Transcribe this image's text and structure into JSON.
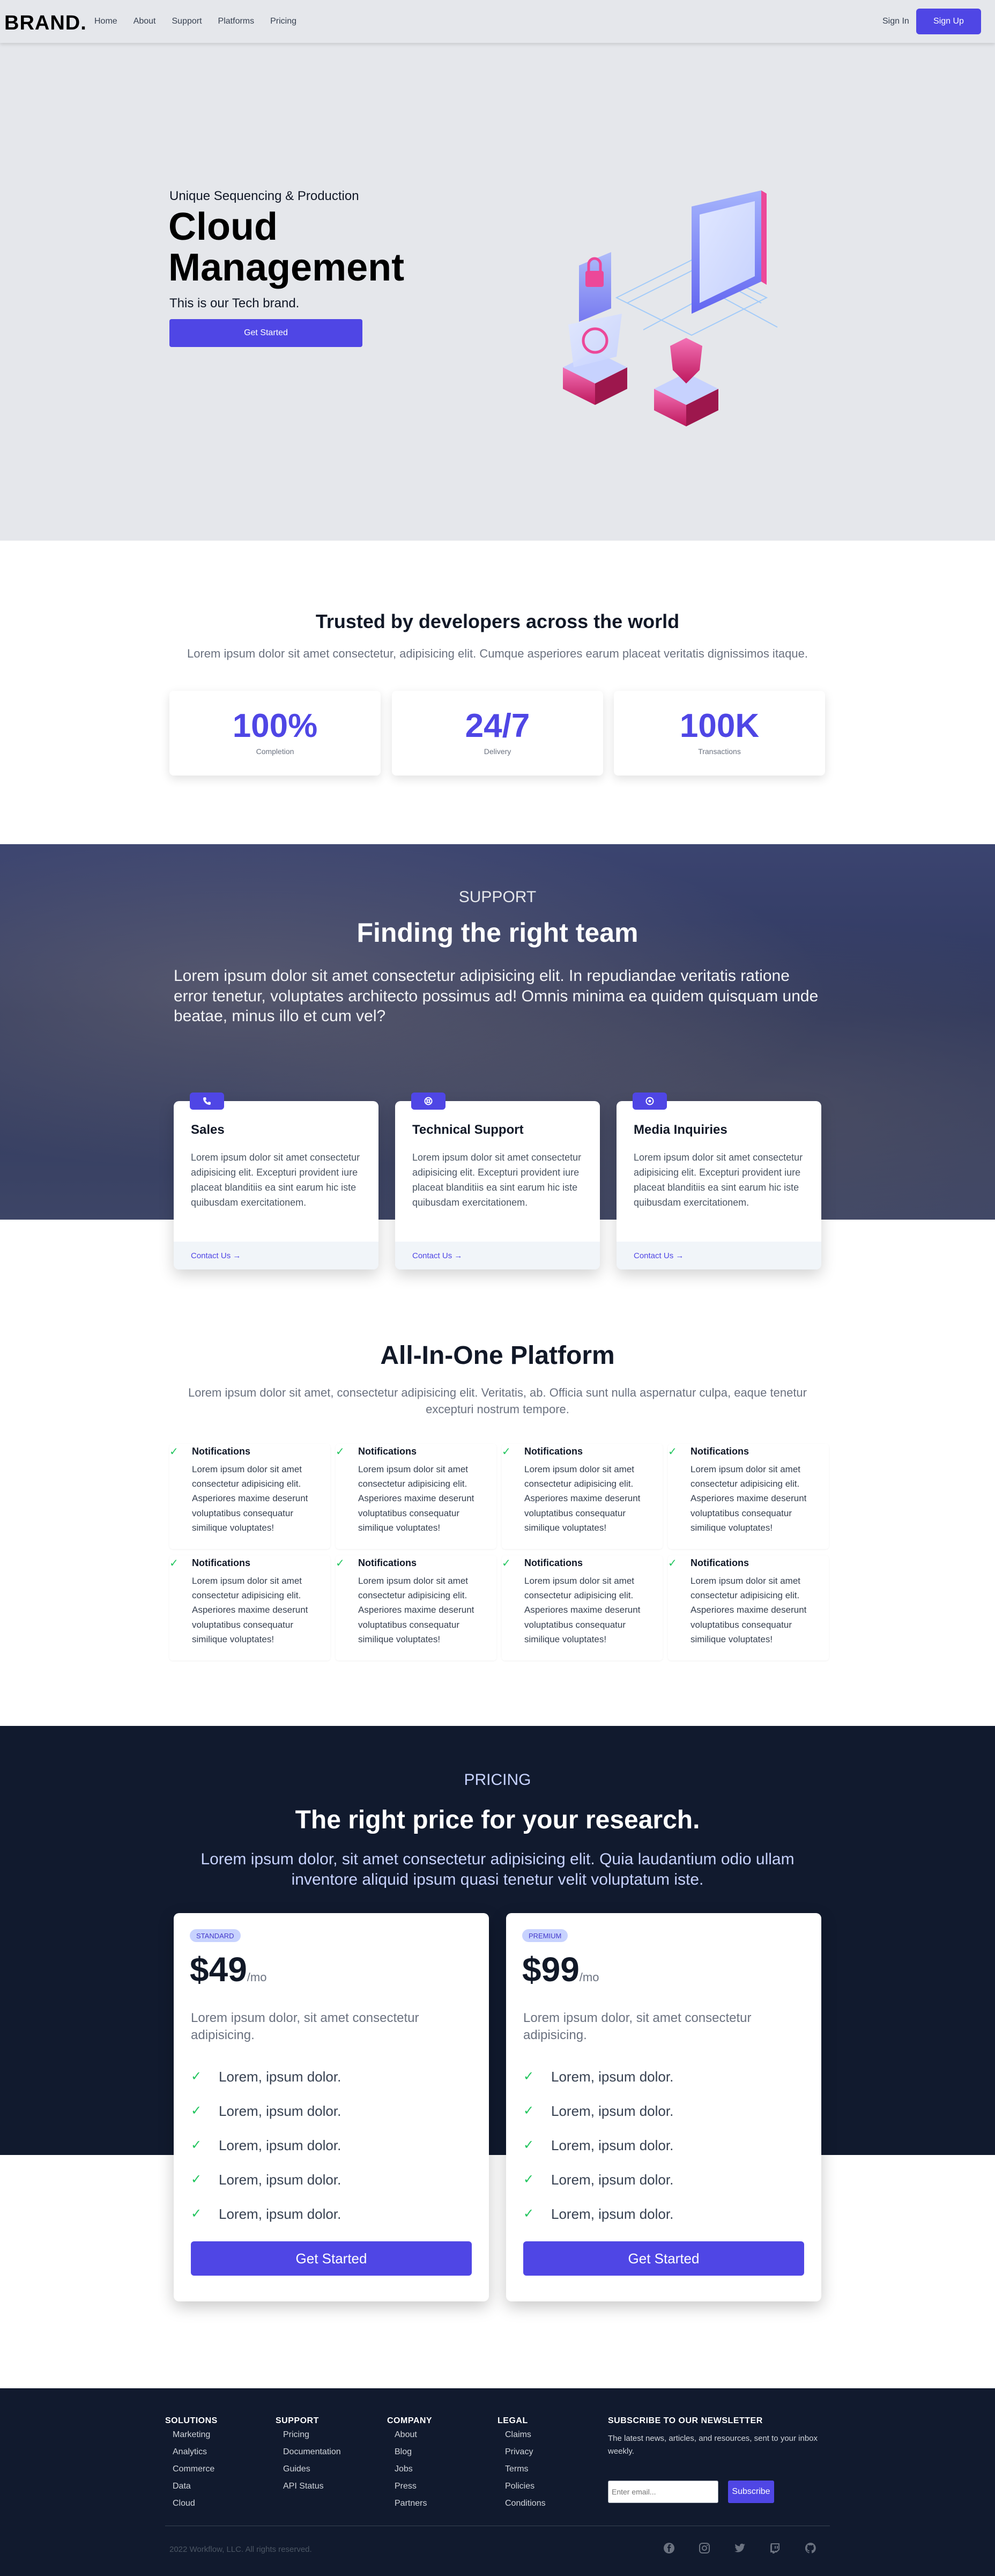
{
  "nav": {
    "brand": "BRAND.",
    "links": [
      "Home",
      "About",
      "Support",
      "Platforms",
      "Pricing"
    ],
    "signin": "Sign In",
    "signup": "Sign Up"
  },
  "hero": {
    "subtitle": "Unique Sequencing & Production",
    "title": "Cloud Management",
    "description": "This is our Tech brand.",
    "cta": "Get Started"
  },
  "trusted": {
    "title": "Trusted by developers across the world",
    "description": "Lorem ipsum dolor sit amet consectetur, adipisicing elit. Cumque asperiores earum placeat veritatis dignissimos itaque.",
    "stats": [
      {
        "value": "100%",
        "label": "Completion"
      },
      {
        "value": "24/7",
        "label": "Delivery"
      },
      {
        "value": "100K",
        "label": "Transactions"
      }
    ]
  },
  "support": {
    "eyebrow": "SUPPORT",
    "title": "Finding the right team",
    "description": "Lorem ipsum dolor sit amet consectetur adipisicing elit. In repudiandae veritatis ratione error tenetur, voluptates architecto possimus ad! Omnis minima ea quidem quisquam unde beatae, minus illo et cum vel?",
    "cards": [
      {
        "icon": "phone-icon",
        "title": "Sales",
        "description": "Lorem ipsum dolor sit amet consectetur adipisicing elit. Excepturi provident iure placeat blanditiis ea sint earum hic iste quibusdam exercitationem.",
        "link": "Contact Us"
      },
      {
        "icon": "support-icon",
        "title": "Technical Support",
        "description": "Lorem ipsum dolor sit amet consectetur adipisicing elit. Excepturi provident iure placeat blanditiis ea sint earum hic iste quibusdam exercitationem.",
        "link": "Contact Us"
      },
      {
        "icon": "target-icon",
        "title": "Media Inquiries",
        "description": "Lorem ipsum dolor sit amet consectetur adipisicing elit. Excepturi provident iure placeat blanditiis ea sint earum hic iste quibusdam exercitationem.",
        "link": "Contact Us"
      }
    ]
  },
  "platform": {
    "title": "All-In-One Platform",
    "description": "Lorem ipsum dolor sit amet, consectetur adipisicing elit. Veritatis, ab. Officia sunt nulla aspernatur culpa, eaque tenetur excepturi nostrum tempore.",
    "features": [
      {
        "title": "Notifications",
        "description": "Lorem ipsum dolor sit amet consectetur adipisicing elit. Asperiores maxime deserunt voluptatibus consequatur similique voluptates!"
      },
      {
        "title": "Notifications",
        "description": "Lorem ipsum dolor sit amet consectetur adipisicing elit. Asperiores maxime deserunt voluptatibus consequatur similique voluptates!"
      },
      {
        "title": "Notifications",
        "description": "Lorem ipsum dolor sit amet consectetur adipisicing elit. Asperiores maxime deserunt voluptatibus consequatur similique voluptates!"
      },
      {
        "title": "Notifications",
        "description": "Lorem ipsum dolor sit amet consectetur adipisicing elit. Asperiores maxime deserunt voluptatibus consequatur similique voluptates!"
      },
      {
        "title": "Notifications",
        "description": "Lorem ipsum dolor sit amet consectetur adipisicing elit. Asperiores maxime deserunt voluptatibus consequatur similique voluptates!"
      },
      {
        "title": "Notifications",
        "description": "Lorem ipsum dolor sit amet consectetur adipisicing elit. Asperiores maxime deserunt voluptatibus consequatur similique voluptates!"
      },
      {
        "title": "Notifications",
        "description": "Lorem ipsum dolor sit amet consectetur adipisicing elit. Asperiores maxime deserunt voluptatibus consequatur similique voluptates!"
      },
      {
        "title": "Notifications",
        "description": "Lorem ipsum dolor sit amet consectetur adipisicing elit. Asperiores maxime deserunt voluptatibus consequatur similique voluptates!"
      }
    ]
  },
  "pricing": {
    "eyebrow": "PRICING",
    "title": "The right price for your research.",
    "description": "Lorem ipsum dolor, sit amet consectetur adipisicing elit. Quia laudantium odio ullam inventore aliquid ipsum quasi tenetur velit voluptatum iste.",
    "plans": [
      {
        "tier": "STANDARD",
        "price": "$49",
        "period": "/mo",
        "description": "Lorem ipsum dolor, sit amet consectetur adipisicing.",
        "features": [
          "Lorem, ipsum dolor.",
          "Lorem, ipsum dolor.",
          "Lorem, ipsum dolor.",
          "Lorem, ipsum dolor.",
          "Lorem, ipsum dolor."
        ],
        "cta": "Get Started"
      },
      {
        "tier": "PREMIUM",
        "price": "$99",
        "period": "/mo",
        "description": "Lorem ipsum dolor, sit amet consectetur adipisicing.",
        "features": [
          "Lorem, ipsum dolor.",
          "Lorem, ipsum dolor.",
          "Lorem, ipsum dolor.",
          "Lorem, ipsum dolor.",
          "Lorem, ipsum dolor."
        ],
        "cta": "Get Started"
      }
    ]
  },
  "footer": {
    "columns": [
      {
        "heading": "SOLUTIONS",
        "links": [
          "Marketing",
          "Analytics",
          "Commerce",
          "Data",
          "Cloud"
        ]
      },
      {
        "heading": "SUPPORT",
        "links": [
          "Pricing",
          "Documentation",
          "Guides",
          "API Status"
        ]
      },
      {
        "heading": "COMPANY",
        "links": [
          "About",
          "Blog",
          "Jobs",
          "Press",
          "Partners"
        ]
      },
      {
        "heading": "LEGAL",
        "links": [
          "Claims",
          "Privacy",
          "Terms",
          "Policies",
          "Conditions"
        ]
      }
    ],
    "newsletter": {
      "heading": "SUBSCRIBE TO OUR NEWSLETTER",
      "description": "The latest news, articles, and resources, sent to your inbox weekly.",
      "placeholder": "Enter email...",
      "button": "Subscribe"
    },
    "copyright": "2022 Workflow, LLC. All rights reserved.",
    "social": [
      "facebook-icon",
      "instagram-icon",
      "twitter-icon",
      "twitch-icon",
      "github-icon"
    ]
  },
  "colors": {
    "accent": "#4f46e5",
    "dark": "#111a2e",
    "hero_bg": "#e5e7eb",
    "check": "#22c55e"
  }
}
